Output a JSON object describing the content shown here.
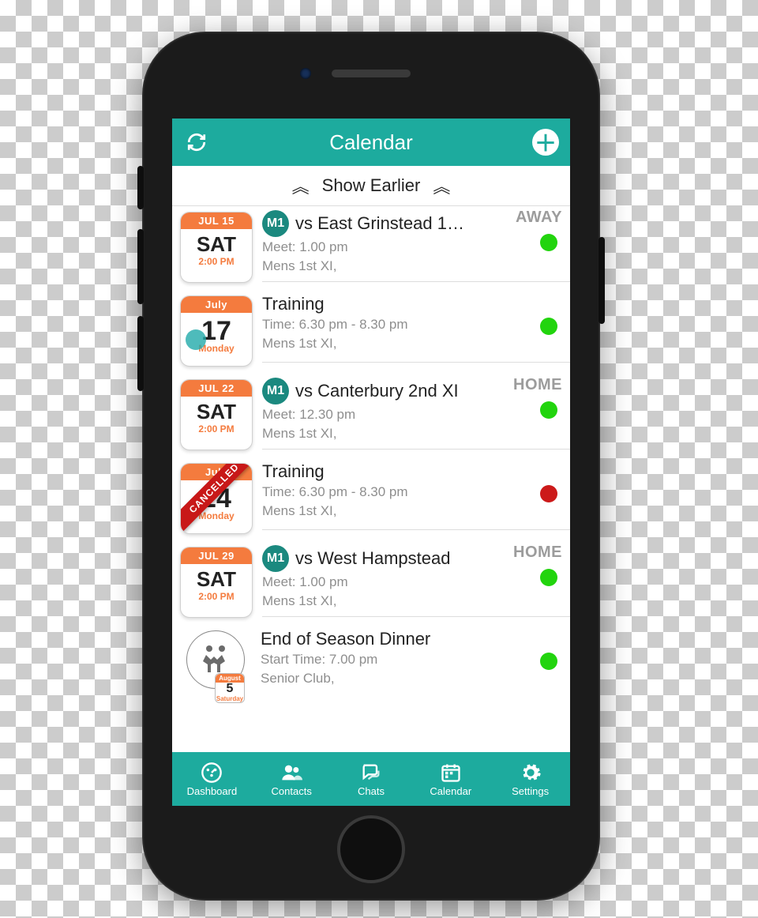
{
  "header": {
    "title": "Calendar"
  },
  "show_earlier": "Show Earlier",
  "events": [
    {
      "date_top": "JUL 15",
      "date_mid": "SAT",
      "date_bot": "2:00 PM",
      "badge": "M1",
      "title": "vs East Grinstead 1…",
      "subtitle1": "Meet: 1.00 pm",
      "subtitle2": "Mens 1st XI,",
      "location": "AWAY",
      "status_color": "green"
    },
    {
      "date_top": "July",
      "date_mid": "17",
      "date_bot": "Monday",
      "title": "Training",
      "subtitle1": "Time: 6.30 pm - 8.30 pm",
      "subtitle2": "Mens 1st XI,",
      "status_color": "green"
    },
    {
      "date_top": "JUL 22",
      "date_mid": "SAT",
      "date_bot": "2:00 PM",
      "badge": "M1",
      "title": "vs Canterbury 2nd XI",
      "subtitle1": "Meet: 12.30 pm",
      "subtitle2": "Mens 1st XI,",
      "location": "HOME",
      "status_color": "green"
    },
    {
      "date_top": "July",
      "date_mid": "24",
      "date_bot": "Monday",
      "cancelled": "CANCELLED",
      "title": "Training",
      "subtitle1": "Time: 6.30 pm - 8.30 pm",
      "subtitle2": "Mens 1st XI,",
      "status_color": "red"
    },
    {
      "date_top": "JUL 29",
      "date_mid": "SAT",
      "date_bot": "2:00 PM",
      "badge": "M1",
      "title": "vs West Hampstead",
      "subtitle1": "Meet: 1.00 pm",
      "subtitle2": "Mens 1st XI,",
      "location": "HOME",
      "status_color": "green"
    },
    {
      "mini_top": "August",
      "mini_day": "5",
      "mini_dow": "Saturday",
      "title": "End of Season Dinner",
      "subtitle1": "Start Time: 7.00 pm",
      "subtitle2": "Senior Club,",
      "status_color": "green"
    }
  ],
  "tabs": {
    "dashboard": "Dashboard",
    "contacts": "Contacts",
    "chats": "Chats",
    "calendar": "Calendar",
    "settings": "Settings"
  }
}
